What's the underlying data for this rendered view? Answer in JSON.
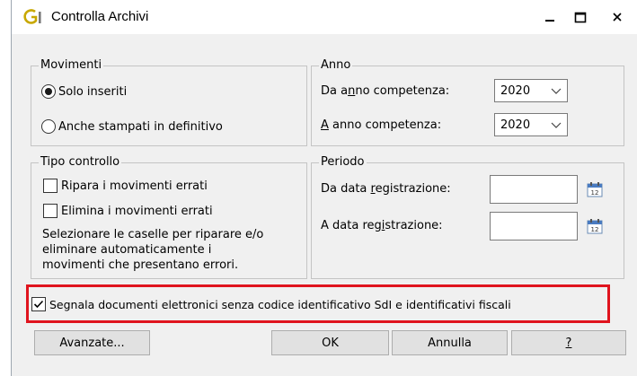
{
  "window": {
    "title": "Controlla Archivi",
    "controls": [
      "minimize-icon",
      "maximize-icon",
      "close-icon"
    ]
  },
  "movimenti": {
    "legend": "Movimenti",
    "options": [
      {
        "label": "Solo inseriti",
        "selected": true
      },
      {
        "label": "Anche stampati in definitivo",
        "selected": false
      }
    ]
  },
  "anno": {
    "legend": "Anno",
    "da_label": "Da anno competenza:",
    "da_value": "2020",
    "a_label": "A anno competenza:",
    "a_value": "2020"
  },
  "tipo_controllo": {
    "legend": "Tipo controllo",
    "ripara_label": "Ripara i movimenti errati",
    "ripara_checked": false,
    "elimina_label": "Elimina i movimenti errati",
    "elimina_checked": false,
    "help_line1": "Selezionare le caselle per riparare e/o",
    "help_line2": "eliminare automaticamente i",
    "help_line3": "movimenti che presentano errori."
  },
  "periodo": {
    "legend": "Periodo",
    "da_label": "Da data registrazione:",
    "da_value": "",
    "a_label": "A data registrazione:",
    "a_value": ""
  },
  "segnala": {
    "label": "Segnala documenti elettronici senza codice identificativo SdI e identificativi fiscali",
    "checked": true
  },
  "buttons": {
    "avanzate": "Avanzate...",
    "ok": "OK",
    "annulla": "Annulla",
    "help": "?"
  },
  "colors": {
    "highlight": "#e0141e",
    "accent": "#c8a800"
  }
}
